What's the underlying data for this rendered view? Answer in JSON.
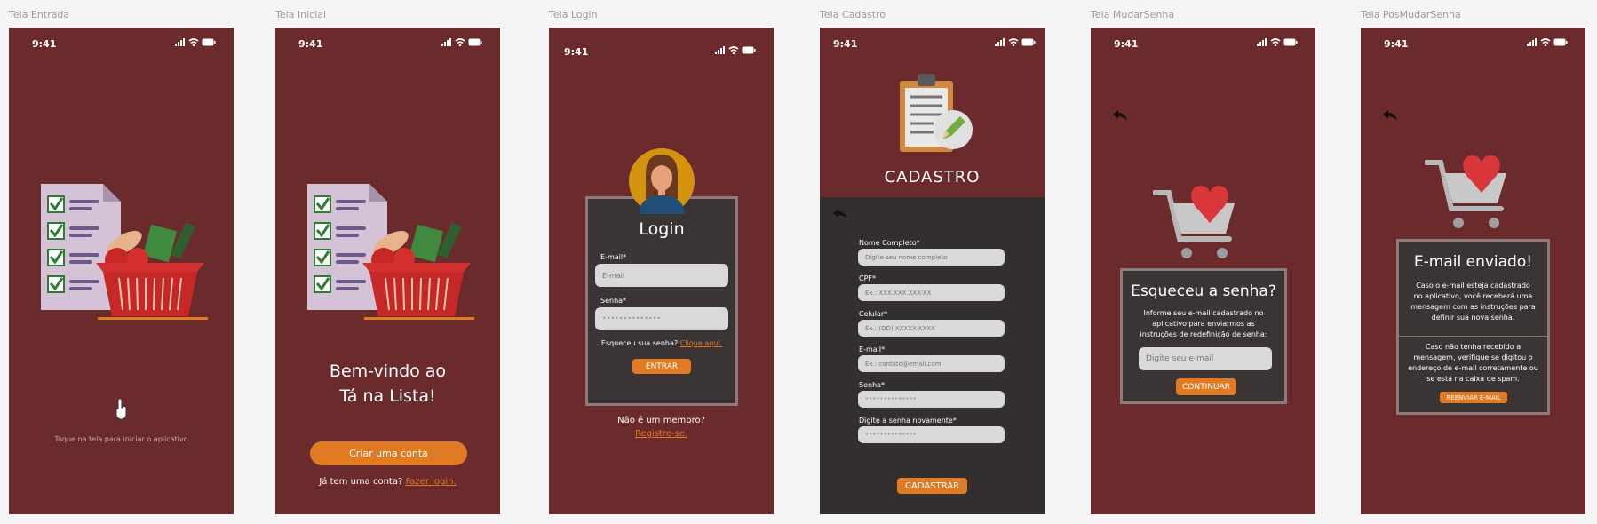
{
  "frames": [
    {
      "label": "Tela Entrada"
    },
    {
      "label": "Tela Inicial"
    },
    {
      "label": "Tela Login"
    },
    {
      "label": "Tela Cadastro"
    },
    {
      "label": "Tela MudarSenha"
    },
    {
      "label": "Tela PosMudarSenha"
    }
  ],
  "status_time": "9:41",
  "entrada": {
    "hint": "Toque na tela para iniciar o aplicativo"
  },
  "inicial": {
    "welcome_line1": "Bem-vindo ao",
    "welcome_line2": "Tá na Lista!",
    "create_button": "Criar uma conta",
    "have_account": "Já tem uma conta?",
    "login_link": "Fazer login."
  },
  "login": {
    "title": "Login",
    "email_label": "E-mail*",
    "email_placeholder": "E-mail",
    "password_label": "Senha*",
    "password_value": "••••••••••••••",
    "forgot_text": "Esqueceu sua senha?",
    "forgot_link": "Clique aqui.",
    "enter_button": "ENTRAR",
    "not_member": "Não é um membro?",
    "register_link": "Registre-se."
  },
  "cadastro": {
    "title": "CADASTRO",
    "fields": [
      {
        "label": "Nome Completo*",
        "placeholder": "Digite seu nome completo"
      },
      {
        "label": "CPF*",
        "placeholder": "Ex.: XXX.XXX.XXX-XX"
      },
      {
        "label": "Celular*",
        "placeholder": "Ex.: (DD) XXXXX-XXXX"
      },
      {
        "label": "E-mail*",
        "placeholder": "Ex.: contato@email.com"
      },
      {
        "label": "Senha*",
        "placeholder": "••••••••••••••"
      },
      {
        "label": "Digite a senha novamente*",
        "placeholder": "••••••••••••••"
      }
    ],
    "submit_button": "CADASTRAR"
  },
  "mudar_senha": {
    "title": "Esqueceu a senha?",
    "instructions_1": "Informe seu e-mail cadastrado no",
    "instructions_2": "aplicativo para enviarmos as",
    "instructions_3": "instruções de redefinição de senha:",
    "email_placeholder": "Digite seu e-mail",
    "continue_button": "CONTINUAR"
  },
  "pos_mudar": {
    "title": "E-mail enviado!",
    "msg1_1": "Caso o e-mail esteja cadastrado",
    "msg1_2": "no aplicativo, você receberá uma",
    "msg1_3": "mensagem com as instruções para",
    "msg1_4": "definir sua nova senha.",
    "msg2_1": "Caso não tenha recebido a",
    "msg2_2": "mensagem, verifique se digitou o",
    "msg2_3": "endereço de e-mail corretamente ou",
    "msg2_4": "se está na caixa de spam.",
    "resend_button": "REENVIAR E-MAIL"
  },
  "colors": {
    "background": "#6b2a2c",
    "accent": "#e07b24",
    "panel": "#332f2f"
  }
}
